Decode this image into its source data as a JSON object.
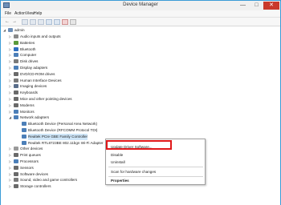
{
  "window": {
    "title": "Device Manager"
  },
  "menu": [
    "File",
    "Action",
    "View",
    "Help"
  ],
  "toolbar": {
    "back": "←",
    "forward": "→"
  },
  "tree": {
    "root": "admin",
    "items": [
      {
        "label": "Audio inputs and outputs",
        "icon_color": "#8a8a8a"
      },
      {
        "label": "Batteries",
        "icon_color": "#5a9a3c"
      },
      {
        "label": "Bluetooth",
        "icon_color": "#2f6fc0"
      },
      {
        "label": "Computer",
        "icon_color": "#4c7fb8"
      },
      {
        "label": "Disk drives",
        "icon_color": "#7a7a7a"
      },
      {
        "label": "Display adapters",
        "icon_color": "#4c7fb8"
      },
      {
        "label": "DVD/CD-ROM drives",
        "icon_color": "#6a6a6a"
      },
      {
        "label": "Human Interface Devices",
        "icon_color": "#7a7a7a"
      },
      {
        "label": "Imaging devices",
        "icon_color": "#5a6e8a"
      },
      {
        "label": "Keyboards",
        "icon_color": "#6a6a6a"
      },
      {
        "label": "Mice and other pointing devices",
        "icon_color": "#6a6a6a"
      },
      {
        "label": "Modems",
        "icon_color": "#6a6a6a"
      },
      {
        "label": "Monitors",
        "icon_color": "#4c7fb8"
      },
      {
        "label": "Network adapters",
        "icon_color": "#4c7fb8"
      }
    ],
    "network_children": [
      {
        "label": "Bluetooth Device (Personal Area Network)"
      },
      {
        "label": "Bluetooth Device (RFCOMM Protocol TDI)"
      },
      {
        "label": "Realtek PCIe GBE Family Controller"
      },
      {
        "label": "Realtek RTL8723BE 802.11bgn Wi-Fi Adapter"
      }
    ],
    "after": [
      {
        "label": "Other devices",
        "icon_color": "#9a9a9a"
      },
      {
        "label": "Print queues",
        "icon_color": "#6a6a6a"
      },
      {
        "label": "Processors",
        "icon_color": "#4c7fb8"
      },
      {
        "label": "Sensors",
        "icon_color": "#6a6a6a"
      },
      {
        "label": "Software devices",
        "icon_color": "#6a6a6a"
      },
      {
        "label": "Sound, video and game controllers",
        "icon_color": "#7a7a7a"
      },
      {
        "label": "Storage controllers",
        "icon_color": "#6a6a6a"
      }
    ]
  },
  "context_menu": {
    "update": "Update Driver Software...",
    "disable": "Disable",
    "uninstall": "Uninstall",
    "scan": "Scan for hardware changes",
    "properties": "Properties"
  },
  "colors": {
    "accent": "#3b9bd6",
    "highlight": "#e0181a",
    "selection": "#cfe6f8"
  }
}
